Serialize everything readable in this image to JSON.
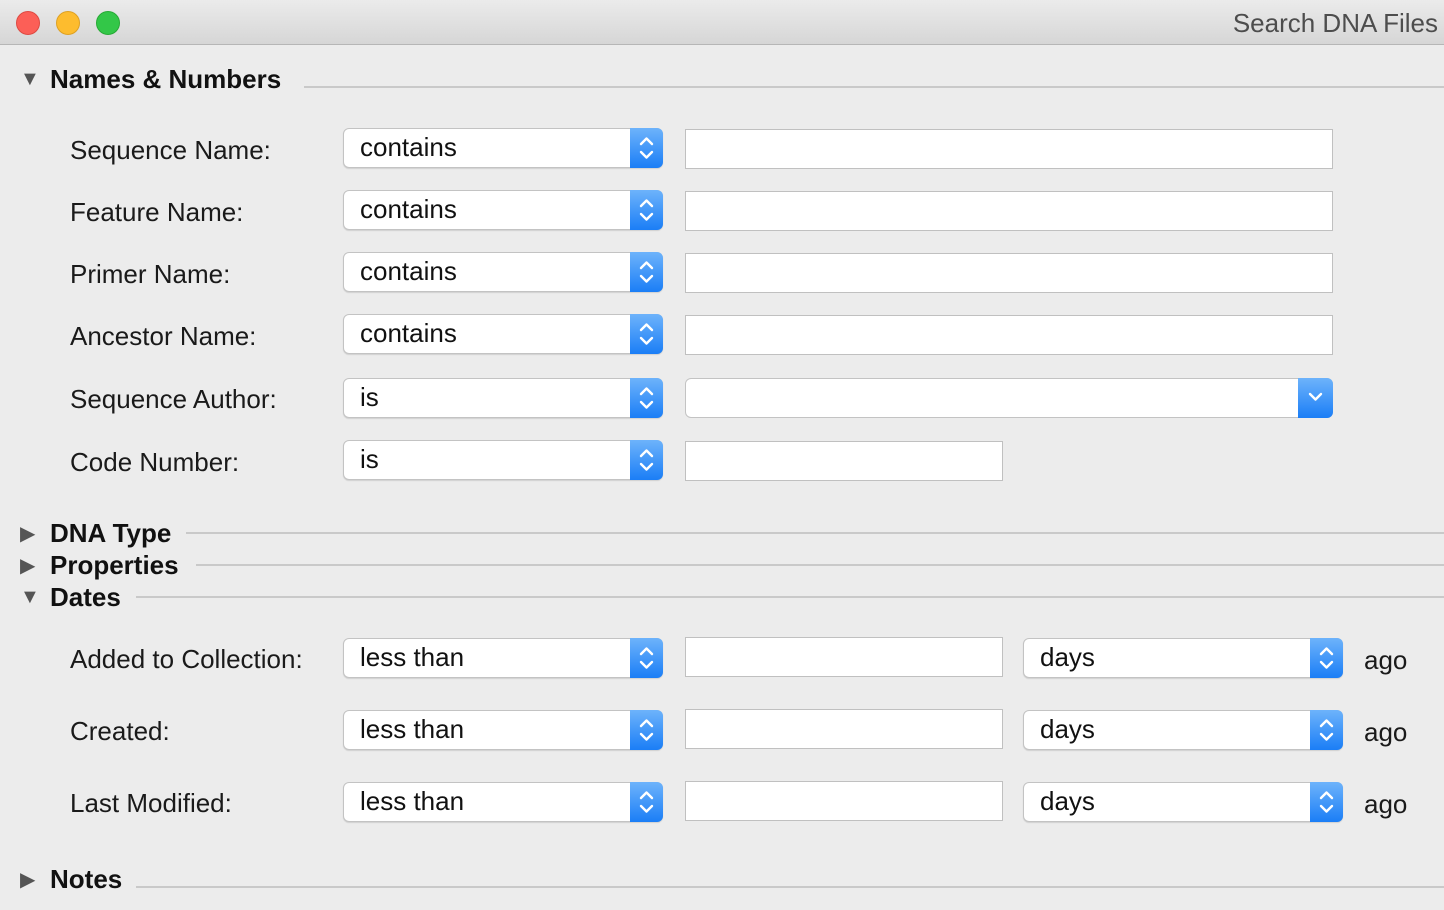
{
  "window": {
    "title": "Search DNA Files"
  },
  "sections": {
    "names_numbers": {
      "title": "Names & Numbers",
      "expanded": true,
      "rows": [
        {
          "label": "Sequence Name:",
          "operator": "contains",
          "value": ""
        },
        {
          "label": "Feature Name:",
          "operator": "contains",
          "value": ""
        },
        {
          "label": "Primer Name:",
          "operator": "contains",
          "value": ""
        },
        {
          "label": "Ancestor Name:",
          "operator": "contains",
          "value": ""
        },
        {
          "label": "Sequence Author:",
          "operator": "is",
          "value": ""
        },
        {
          "label": "Code Number:",
          "operator": "is",
          "value": ""
        }
      ]
    },
    "dna_type": {
      "title": "DNA Type",
      "expanded": false
    },
    "properties": {
      "title": "Properties",
      "expanded": false
    },
    "dates": {
      "title": "Dates",
      "expanded": true,
      "rows": [
        {
          "label": "Added to Collection:",
          "operator": "less than",
          "value": "",
          "unit": "days",
          "suffix": "ago"
        },
        {
          "label": "Created:",
          "operator": "less than",
          "value": "",
          "unit": "days",
          "suffix": "ago"
        },
        {
          "label": "Last Modified:",
          "operator": "less than",
          "value": "",
          "unit": "days",
          "suffix": "ago"
        }
      ]
    },
    "notes": {
      "title": "Notes",
      "expanded": false
    }
  },
  "icons": {
    "expanded": "triangle-down-icon",
    "collapsed": "triangle-right-icon",
    "popup": "up-down-chevron-icon",
    "combo": "chevron-down-icon"
  },
  "colors": {
    "accent": "#1b7ef6",
    "close": "#fc5f57",
    "minimize": "#fdbc2e",
    "maximize": "#33c748"
  }
}
